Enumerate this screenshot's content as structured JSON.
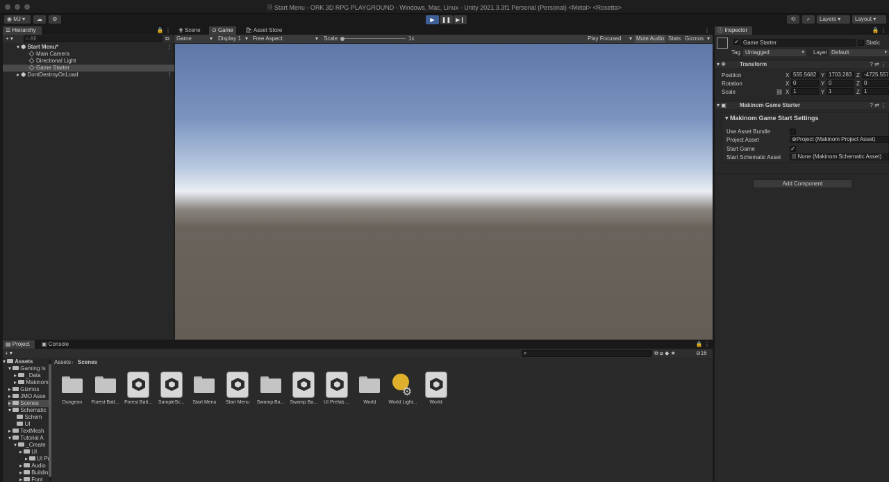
{
  "window": {
    "title": "Start Menu - ORK 3D RPG PLAYGROUND - Windows, Mac, Linux - Unity 2021.3.3f1 Personal (Personal) <Metal> <Rosetta>"
  },
  "toolbar": {
    "account": "MJ",
    "layers": "Layers",
    "layout": "Layout"
  },
  "hierarchy": {
    "tab": "Hierarchy",
    "search_placeholder": "All",
    "items": [
      {
        "label": "Start Menu*"
      },
      {
        "label": "Main Camera"
      },
      {
        "label": "Directional Light"
      },
      {
        "label": "Game Starter"
      },
      {
        "label": "DontDestroyOnLoad"
      }
    ]
  },
  "center_tabs": {
    "scene": "Scene",
    "game": "Game",
    "asset_store": "Asset Store"
  },
  "game_toolbar": {
    "mode": "Game",
    "display": "Display 1",
    "aspect": "Free Aspect",
    "scale_label": "Scale",
    "scale_value": "1x",
    "play_focused": "Play Focused",
    "mute_audio": "Mute Audio",
    "stats": "Stats",
    "gizmos": "Gizmos"
  },
  "inspector": {
    "tab": "Inspector",
    "object_name": "Game Starter",
    "static_label": "Static",
    "tag_label": "Tag",
    "tag_value": "Untagged",
    "layer_label": "Layer",
    "layer_value": "Default",
    "transform": {
      "title": "Transform",
      "position_label": "Position",
      "rotation_label": "Rotation",
      "scale_label": "Scale",
      "x": "X",
      "y": "Y",
      "z": "Z",
      "position": [
        "555.5682",
        "1703.283",
        "-4725.557"
      ],
      "rotation": [
        "0",
        "0",
        "0"
      ],
      "scale": [
        "1",
        "1",
        "1"
      ]
    },
    "component": {
      "title": "Makinom Game Starter",
      "section": "Makinom Game Start Settings",
      "use_asset_bundle": "Use Asset Bundle",
      "project_asset": "Project Asset",
      "project_asset_value": "Project (Makinom Project Asset)",
      "start_game": "Start Game",
      "start_schematic_asset": "Start Schematic Asset",
      "start_schematic_value": "None (Makinom Schematic Asset)"
    },
    "add_component": "Add Component"
  },
  "project": {
    "tab_project": "Project",
    "tab_console": "Console",
    "item_count": "16",
    "breadcrumb_root": "Assets",
    "breadcrumb_current": "Scenes",
    "tree": [
      "Assets",
      "Gaming Is",
      "_Data",
      "Makinom",
      "Gizmos",
      "JMO Asse",
      "Scenes",
      "Schematic",
      "Schem",
      "UI",
      "TextMesh",
      "Tutorial A",
      "_Create",
      "UI",
      "UI Pr",
      "Audio",
      "Buildin",
      "Font"
    ],
    "assets": [
      {
        "label": "Dungeon",
        "kind": "folder"
      },
      {
        "label": "Forest Batt...",
        "kind": "folder"
      },
      {
        "label": "Forest Batt...",
        "kind": "scene"
      },
      {
        "label": "SampleSc...",
        "kind": "scene"
      },
      {
        "label": "Start Menu",
        "kind": "folder"
      },
      {
        "label": "Start Menu",
        "kind": "scene"
      },
      {
        "label": "Swamp Ba...",
        "kind": "folder"
      },
      {
        "label": "Swamp Ba...",
        "kind": "scene"
      },
      {
        "label": "UI Prefab ...",
        "kind": "scene"
      },
      {
        "label": "World",
        "kind": "folder"
      },
      {
        "label": "World Light...",
        "kind": "lighting"
      },
      {
        "label": "World",
        "kind": "scene"
      }
    ]
  },
  "colors": {
    "accent": "#4c7bd1",
    "sky_top": "#5e77a6",
    "ground": "#665f58"
  }
}
